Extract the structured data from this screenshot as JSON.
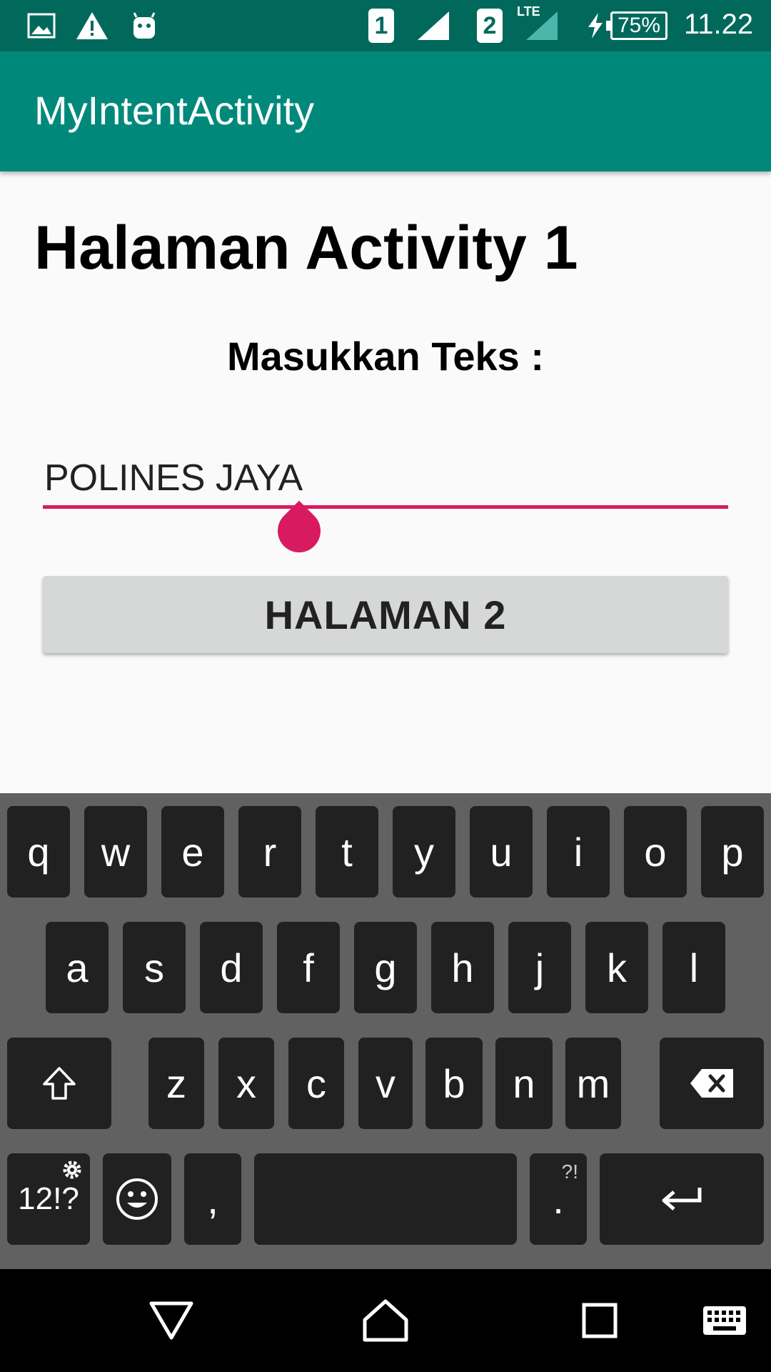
{
  "status_bar": {
    "sim1": "1",
    "sim2": "2",
    "network_type": "LTE",
    "battery": "75%",
    "time": "11.22",
    "icons": [
      "image-icon",
      "warning-icon",
      "android-icon",
      "signal-icon",
      "charging-icon",
      "battery-icon"
    ]
  },
  "app_bar": {
    "title": "MyIntentActivity"
  },
  "main": {
    "heading": "Halaman Activity 1",
    "input_label": "Masukkan Teks :",
    "input_value": "POLINES JAYA",
    "button_label": "HALAMAN 2"
  },
  "keyboard": {
    "row1": [
      "q",
      "w",
      "e",
      "r",
      "t",
      "y",
      "u",
      "i",
      "o",
      "p"
    ],
    "row2": [
      "a",
      "s",
      "d",
      "f",
      "g",
      "h",
      "j",
      "k",
      "l"
    ],
    "row3": [
      "z",
      "x",
      "c",
      "v",
      "b",
      "n",
      "m"
    ],
    "symbols_key": "12!?",
    "comma_key": ",",
    "period_key": ".",
    "period_sub": "?!"
  },
  "nav_bar": {
    "icons": [
      "back-icon",
      "home-icon",
      "recents-icon",
      "keyboard-icon"
    ]
  },
  "colors": {
    "primary": "#00897b",
    "primary_dark": "#00695c",
    "accent": "#d81b60",
    "button": "#d6d7d7",
    "key": "#212121",
    "keyboard_bg": "#616161"
  }
}
